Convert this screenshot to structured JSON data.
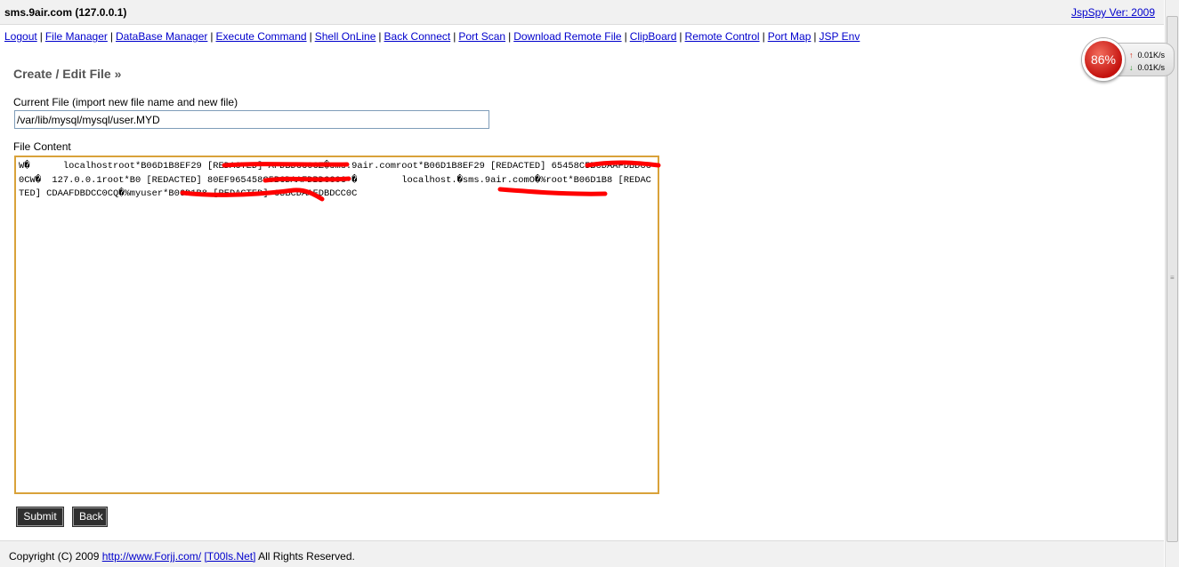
{
  "header": {
    "host_title": "sms.9air.com (127.0.0.1)",
    "version_link": "JspSpy Ver: 2009"
  },
  "nav": {
    "items": [
      "Logout",
      "File Manager",
      "DataBase Manager",
      "Execute Command",
      "Shell OnLine",
      "Back Connect",
      "Port Scan",
      "Download Remote File",
      "ClipBoard",
      "Remote Control",
      "Port Map",
      "JSP Env"
    ],
    "separator": "|"
  },
  "form": {
    "section_title": "Create / Edit File »",
    "current_file_label": "Current File (import new file name and new file)",
    "current_file_value": "/var/lib/mysql/mysql/user.MYD",
    "file_content_label": "File Content",
    "file_content_value": "W�      localhostroot*B06D1B8EF29 [REDACTED] AFDBDCC0CZ�sms.9air.comroot*B06D1B8EF29 [REDACTED] 65458C5BCDAAFDBDCC0CW�  127.0.0.1root*B0 [REDACTED] 80EF965458C5BCDAAFDBDCC0C+�        localhost.�sms.9air.comO�%root*B06D1B8 [REDACTED] CDAAFDBDCC0CQ�%myuser*B06D1B8 [REDACTED] C5BCDAAFDBDCC0C\n",
    "submit_label": "Submit",
    "back_label": "Back"
  },
  "footer": {
    "copyright_prefix": "Copyright (C) 2009",
    "site_link": "http://www.Forjj.com/",
    "tools_link": "[T00ls.Net]",
    "rights": "All Rights Reserved."
  },
  "speed_widget": {
    "percent": "86%",
    "upload": "0.01K/s",
    "download": "0.01K/s",
    "gauge_color": "#c4120e"
  },
  "icons": {
    "up": "up-arrow-icon",
    "down": "down-arrow-icon"
  }
}
